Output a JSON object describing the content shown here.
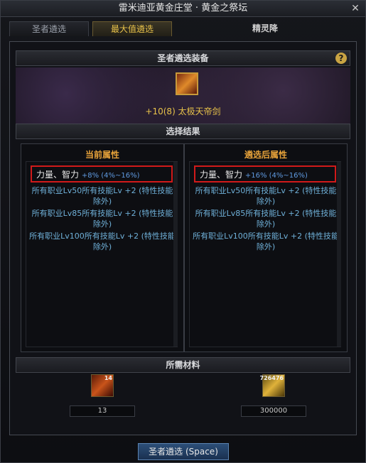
{
  "window": {
    "title": "雷米迪亚黄金庄堂 · 黄金之祭坛",
    "close": "✕"
  },
  "tabs": [
    {
      "label": "圣者遴选"
    },
    {
      "label": "最大值遴选"
    },
    {
      "label": "精灵降"
    }
  ],
  "panel": {
    "equip_header": "圣者遴选装备",
    "help": "?",
    "equip_name": "+10(8) 太极天帝剑",
    "result_header": "选择结果",
    "current": {
      "title": "当前属性",
      "main_stat": "力量、智力",
      "main_pct": "+8% (4%~16%)",
      "lines": [
        "所有职业Lv50所有技能Lv +2 (特性技能除外)",
        "所有职业Lv85所有技能Lv +2 (特性技能除外)",
        "所有职业Lv100所有技能Lv +2 (特性技能除外)"
      ]
    },
    "after": {
      "title": "遴选后属性",
      "main_stat": "力量、智力",
      "main_pct": "+16% (4%~16%)",
      "lines": [
        "所有职业Lv50所有技能Lv +2 (特性技能除外)",
        "所有职业Lv85所有技能Lv +2 (特性技能除外)",
        "所有职业Lv100所有技能Lv +2 (特性技能除外)"
      ]
    },
    "materials_header": "所需材料",
    "materials": [
      {
        "count": "14",
        "qty": "13",
        "icon": "orb-icon"
      },
      {
        "count": "726476",
        "qty": "300000",
        "icon": "gold-coin-icon"
      }
    ]
  },
  "action_button": "圣者遴选 (Space)"
}
